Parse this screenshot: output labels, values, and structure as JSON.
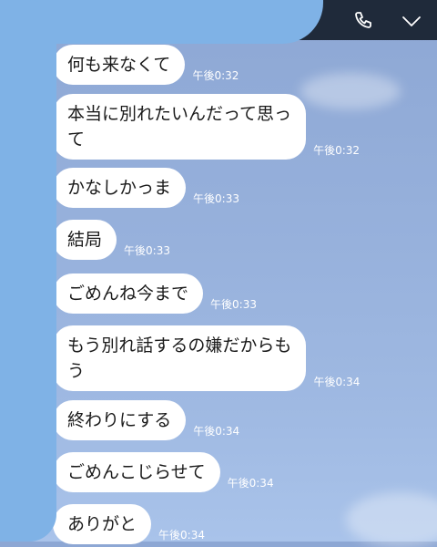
{
  "header": {
    "call_icon": "phone-icon",
    "menu_icon": "chevron-down-icon"
  },
  "messages": [
    {
      "text": "何も来なくて",
      "time": "午後0:32"
    },
    {
      "text": "本当に別れたいんだって思っ\nて",
      "time": "午後0:32"
    },
    {
      "text": "かなしかっま",
      "time": "午後0:33"
    },
    {
      "text": "結局",
      "time": "午後0:33"
    },
    {
      "text": "ごめんね今まで",
      "time": "午後0:33"
    },
    {
      "text": "もう別れ話するの嫌だからも\nう",
      "time": "午後0:34"
    },
    {
      "text": "終わりにする",
      "time": "午後0:34"
    },
    {
      "text": "ごめんこじらせて",
      "time": "午後0:34"
    },
    {
      "text": "ありがと",
      "time": "午後0:34"
    }
  ]
}
